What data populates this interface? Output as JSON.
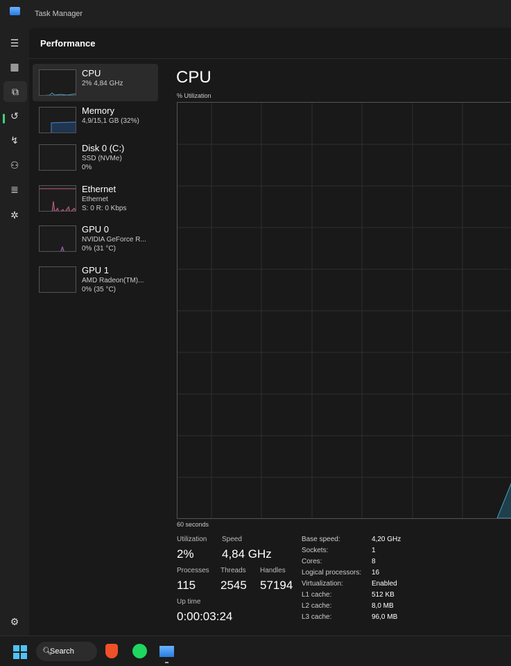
{
  "window": {
    "title": "Task Manager"
  },
  "header": {
    "title": "Performance"
  },
  "rail": {
    "icons": [
      "hamburger-menu-icon",
      "processes-icon",
      "performance-icon",
      "app-history-icon",
      "startup-apps-icon",
      "users-icon",
      "details-icon",
      "services-icon",
      "settings-icon"
    ]
  },
  "devices": [
    {
      "name": "CPU",
      "sub1": "2% 4,84 GHz",
      "sub2": ""
    },
    {
      "name": "Memory",
      "sub1": "4,9/15,1 GB (32%)",
      "sub2": ""
    },
    {
      "name": "Disk 0 (C:)",
      "sub1": "SSD (NVMe)",
      "sub2": "0%"
    },
    {
      "name": "Ethernet",
      "sub1": "Ethernet",
      "sub2": "S: 0 R: 0 Kbps"
    },
    {
      "name": "GPU 0",
      "sub1": "NVIDIA GeForce R...",
      "sub2": "0% (31 °C)"
    },
    {
      "name": "GPU 1",
      "sub1": "AMD Radeon(TM)...",
      "sub2": "0% (35 °C)"
    }
  ],
  "detail": {
    "title": "CPU",
    "graph_label": "% Utilization",
    "time_label": "60 seconds",
    "utilization_label": "Utilization",
    "utilization": "2%",
    "speed_label": "Speed",
    "speed": "4,84 GHz",
    "processes_label": "Processes",
    "processes": "115",
    "threads_label": "Threads",
    "threads": "2545",
    "handles_label": "Handles",
    "handles": "57194",
    "uptime_label": "Up time",
    "uptime": "0:00:03:24",
    "specs": [
      {
        "k": "Base speed:",
        "v": "4,20 GHz"
      },
      {
        "k": "Sockets:",
        "v": "1"
      },
      {
        "k": "Cores:",
        "v": "8"
      },
      {
        "k": "Logical processors:",
        "v": "16"
      },
      {
        "k": "Virtualization:",
        "v": "Enabled"
      },
      {
        "k": "L1 cache:",
        "v": "512 KB"
      },
      {
        "k": "L2 cache:",
        "v": "8,0 MB"
      },
      {
        "k": "L3 cache:",
        "v": "96,0 MB"
      }
    ]
  },
  "chart_data": {
    "type": "area",
    "ylim": [
      0,
      100
    ],
    "xlabel": "60 seconds",
    "ylabel": "% Utilization",
    "grid": true,
    "color": "#4aa3c7",
    "values_recent": [
      0,
      12
    ]
  },
  "taskbar": {
    "search_label": "Search",
    "apps": [
      "brave-icon",
      "spotify-icon",
      "task-manager-icon"
    ]
  }
}
